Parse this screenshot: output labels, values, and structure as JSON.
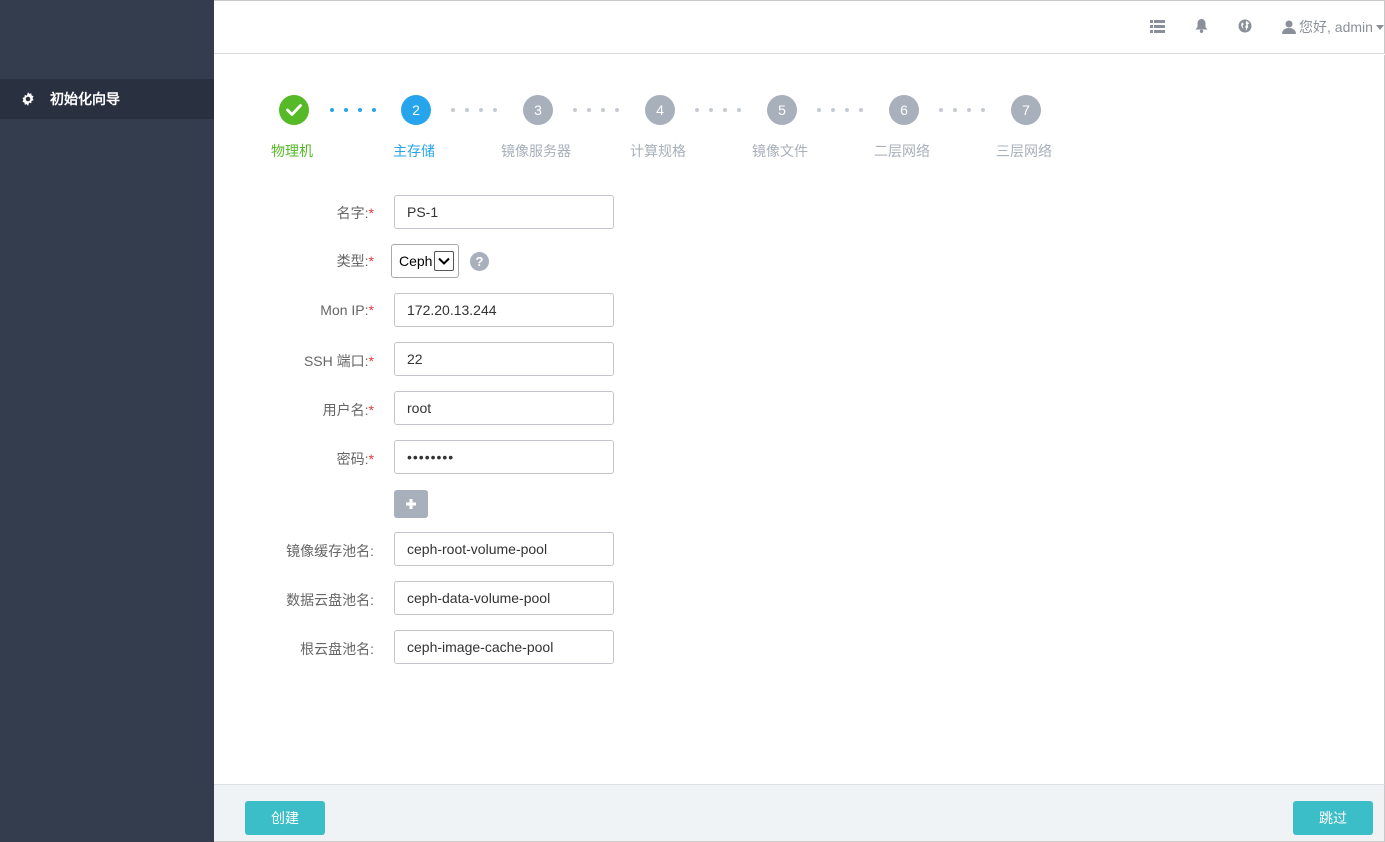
{
  "sidebar": {
    "items": [
      {
        "label": "初始化向导",
        "icon": "gear-icon"
      }
    ]
  },
  "topbar": {
    "icons": [
      "list-icon",
      "bell-icon",
      "globe-icon"
    ],
    "user_greeting": "您好, admin",
    "user_icon": "user-icon"
  },
  "wizard": {
    "steps": [
      {
        "number": "✔",
        "label": "物理机",
        "state": "done"
      },
      {
        "number": "2",
        "label": "主存储",
        "state": "active"
      },
      {
        "number": "3",
        "label": "镜像服务器",
        "state": "todo"
      },
      {
        "number": "4",
        "label": "计算规格",
        "state": "todo"
      },
      {
        "number": "5",
        "label": "镜像文件",
        "state": "todo"
      },
      {
        "number": "6",
        "label": "二层网络",
        "state": "todo"
      },
      {
        "number": "7",
        "label": "三层网络",
        "state": "todo"
      }
    ]
  },
  "form": {
    "required_mark": "*",
    "name": {
      "label": "名字:",
      "value": "PS-1"
    },
    "type": {
      "label": "类型:",
      "value": "Ceph",
      "help": "?"
    },
    "mon_ip": {
      "label": "Mon IP:",
      "value": "172.20.13.244"
    },
    "ssh_port": {
      "label": "SSH 端口:",
      "value": "22"
    },
    "username": {
      "label": "用户名:",
      "value": "root"
    },
    "password": {
      "label": "密码:",
      "value": "••••••••"
    },
    "add_button": "+",
    "image_cache_pool": {
      "label": "镜像缓存池名:",
      "value": "ceph-root-volume-pool"
    },
    "data_volume_pool": {
      "label": "数据云盘池名:",
      "value": "ceph-data-volume-pool"
    },
    "root_volume_pool": {
      "label": "根云盘池名:",
      "value": "ceph-image-cache-pool"
    }
  },
  "footer": {
    "create_label": "创建",
    "skip_label": "跳过"
  },
  "colors": {
    "sidebar_bg": "#333d4e",
    "sidebar_active_bg": "#293140",
    "step_done": "#55b928",
    "step_active": "#27a5ec",
    "step_todo": "#a8b0bb",
    "button": "#3bbec7",
    "required": "#e53935"
  }
}
